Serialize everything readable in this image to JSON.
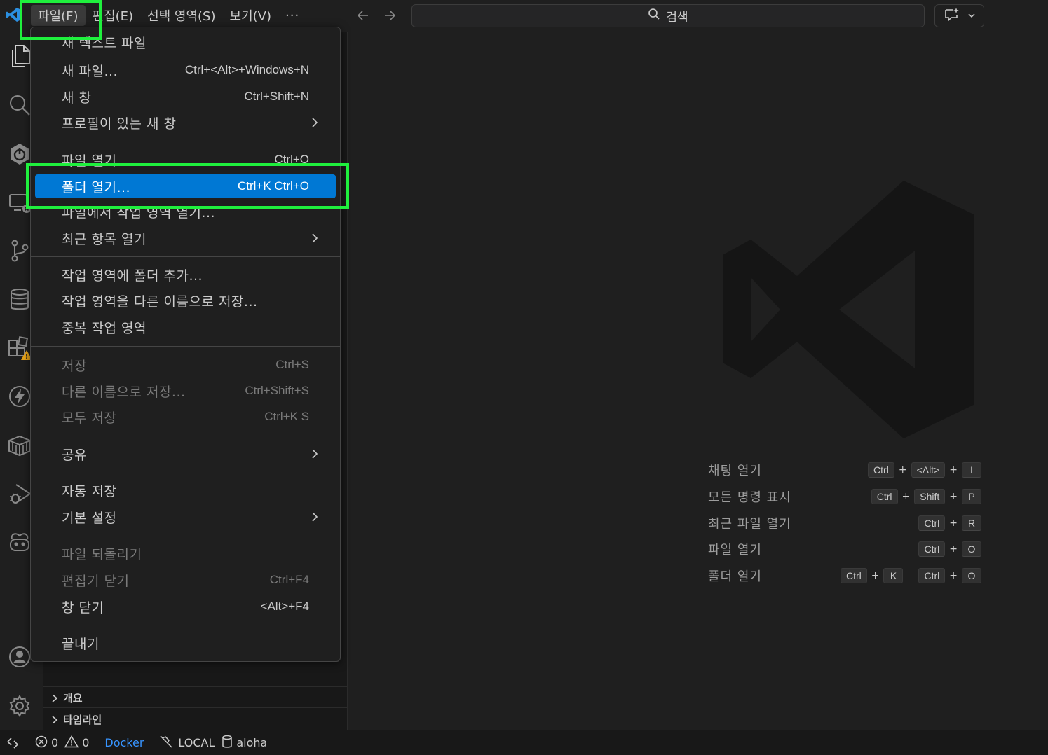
{
  "menubar": {
    "items": [
      {
        "label": "파일(F)"
      },
      {
        "label": "편집(E)"
      },
      {
        "label": "선택 영역(S)"
      },
      {
        "label": "보기(V)"
      }
    ],
    "more": "···"
  },
  "search": {
    "text": "검색"
  },
  "file_menu": {
    "items": [
      {
        "label": "새 텍스트 파일",
        "shortcut": ""
      },
      {
        "label": "새 파일...",
        "shortcut": "Ctrl+<Alt>+Windows+N"
      },
      {
        "label": "새 창",
        "shortcut": "Ctrl+Shift+N"
      },
      {
        "label": "프로필이 있는 새 창",
        "shortcut": ""
      },
      {
        "label": "파일 열기...",
        "shortcut": "Ctrl+O"
      },
      {
        "label": "폴더 열기...",
        "shortcut": "Ctrl+K Ctrl+O"
      },
      {
        "label": "파일에서 작업 영역 열기...",
        "shortcut": ""
      },
      {
        "label": "최근 항목 열기",
        "shortcut": ""
      },
      {
        "label": "작업 영역에 폴더 추가...",
        "shortcut": ""
      },
      {
        "label": "작업 영역을 다른 이름으로 저장...",
        "shortcut": ""
      },
      {
        "label": "중복 작업 영역",
        "shortcut": ""
      },
      {
        "label": "저장",
        "shortcut": "Ctrl+S"
      },
      {
        "label": "다른 이름으로 저장...",
        "shortcut": "Ctrl+Shift+S"
      },
      {
        "label": "모두 저장",
        "shortcut": "Ctrl+K S"
      },
      {
        "label": "공유",
        "shortcut": ""
      },
      {
        "label": "자동 저장",
        "shortcut": ""
      },
      {
        "label": "기본 설정",
        "shortcut": ""
      },
      {
        "label": "파일 되돌리기",
        "shortcut": ""
      },
      {
        "label": "편집기 닫기",
        "shortcut": "Ctrl+F4"
      },
      {
        "label": "창 닫기",
        "shortcut": "<Alt>+F4"
      },
      {
        "label": "끝내기",
        "shortcut": ""
      }
    ]
  },
  "sidebar": {
    "sections": [
      {
        "label": "개요"
      },
      {
        "label": "타임라인"
      }
    ]
  },
  "shortcuts": {
    "rows": [
      {
        "label": "채팅 열기",
        "keys": [
          "Ctrl",
          "<Alt>",
          "I"
        ]
      },
      {
        "label": "모든 명령 표시",
        "keys": [
          "Ctrl",
          "Shift",
          "P"
        ]
      },
      {
        "label": "최근 파일 열기",
        "keys": [
          "Ctrl",
          "R"
        ]
      },
      {
        "label": "파일 열기",
        "keys": [
          "Ctrl",
          "O"
        ]
      },
      {
        "label": "폴더 열기",
        "keys": [
          "Ctrl",
          "K",
          "Ctrl",
          "O"
        ]
      }
    ]
  },
  "statusbar": {
    "errors": "0",
    "warnings": "0",
    "docker": "Docker",
    "connection": "LOCAL",
    "database": "aloha"
  },
  "colors": {
    "accent": "#0078d4",
    "highlight": "#1ff03d",
    "background": "#1f1f1f"
  }
}
